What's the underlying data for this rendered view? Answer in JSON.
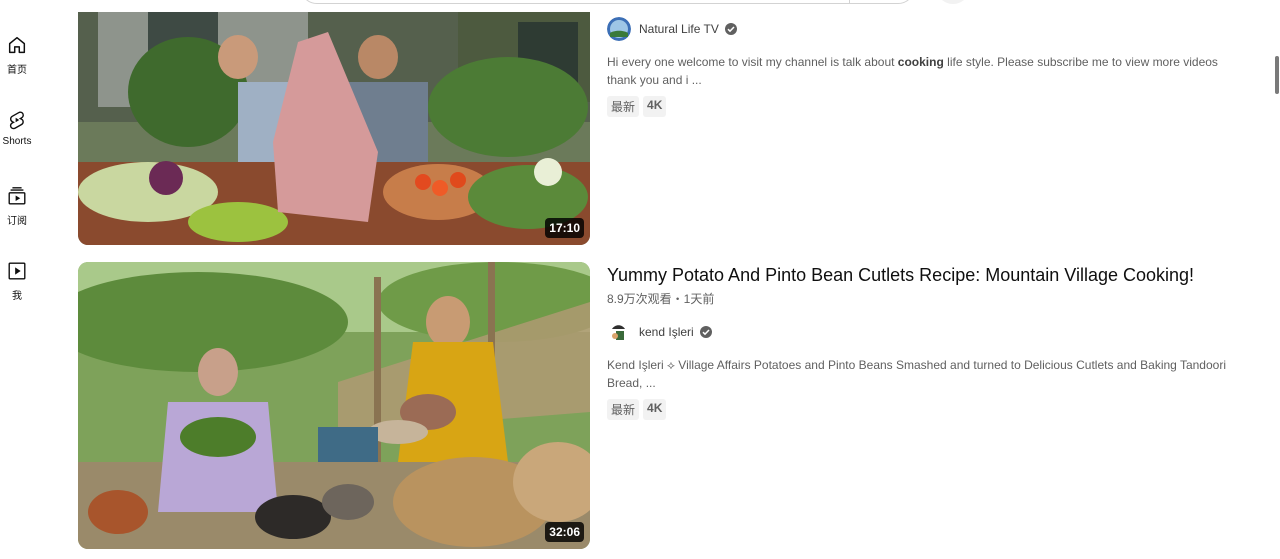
{
  "guide": {
    "items": [
      {
        "icon": "home-icon",
        "label": "首页"
      },
      {
        "icon": "shorts-icon",
        "label": "Shorts"
      },
      {
        "icon": "subscriptions-icon",
        "label": "订阅"
      },
      {
        "icon": "you-icon",
        "label": "我"
      }
    ]
  },
  "videos": [
    {
      "duration": "17:10",
      "channel": "Natural Life TV",
      "description_before": "Hi every one welcome to visit my channel is talk about ",
      "description_highlight": "cooking",
      "description_after": " life style. Please subscribe me to view more videos thank you and i ...",
      "badges": [
        "最新",
        "4K"
      ]
    },
    {
      "duration": "32:06",
      "title": "Yummy Potato And Pinto Bean Cutlets Recipe: Mountain Village Cooking!",
      "stats": "8.9万次观看・1天前",
      "channel": "kend Işleri",
      "description": "Kend Işleri ⟡ Village Affairs Potatoes and Pinto Beans Smashed and turned to Delicious Cutlets and Baking Tandoori Bread, ...",
      "badges": [
        "最新",
        "4K"
      ]
    }
  ],
  "colors": {
    "text": "#0f0f0f",
    "secondary": "#606060",
    "badge_bg": "#f2f2f2",
    "verified": "#606060"
  }
}
